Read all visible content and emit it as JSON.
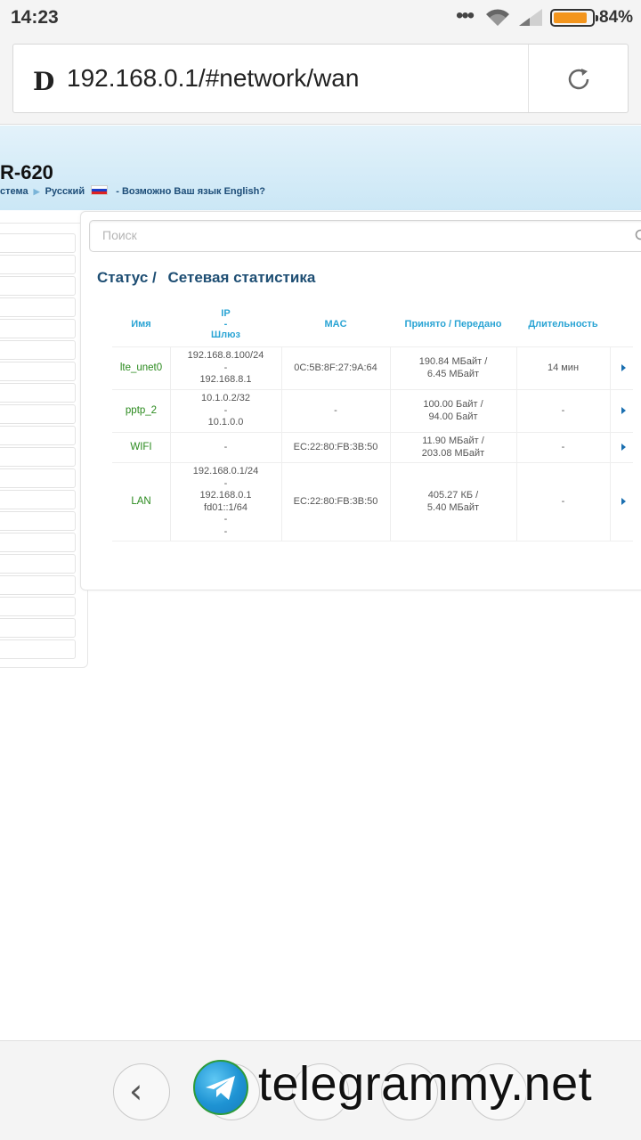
{
  "status_bar": {
    "time": "14:23",
    "battery_percent": "84%",
    "battery_level": 0.84,
    "battery_color": "#f3951d"
  },
  "browser": {
    "url": "192.168.0.1/#network/wan",
    "site_icon": "D",
    "reload_icon": "reload-icon"
  },
  "header": {
    "model": "R-620",
    "breadcrumb_system": "стема",
    "language": "Русский",
    "language_hint": "- Возможно Ваш язык English?"
  },
  "search": {
    "placeholder": "Поиск"
  },
  "page": {
    "crumb_1": "Статус /",
    "crumb_2": "Сетевая статистика"
  },
  "table": {
    "headers": {
      "name": "Имя",
      "ip_1": "IP",
      "ip_2": "-",
      "ip_3": "Шлюз",
      "mac": "MAC",
      "traffic": "Принято / Передано",
      "duration": "Длительность"
    },
    "rows": [
      {
        "name": "lte_unet0",
        "ip_lines": [
          "192.168.8.100/24",
          "-",
          "192.168.8.1"
        ],
        "mac": "0C:5B:8F:27:9A:64",
        "traffic_lines": [
          "190.84 МБайт /",
          "6.45 МБайт"
        ],
        "duration": "14 мин"
      },
      {
        "name": "pptp_2",
        "ip_lines": [
          "10.1.0.2/32",
          "-",
          "10.1.0.0"
        ],
        "mac": "-",
        "traffic_lines": [
          "100.00 Байт /",
          "94.00 Байт"
        ],
        "duration": "-"
      },
      {
        "name": "WIFI",
        "ip_lines": [
          "-"
        ],
        "mac": "EC:22:80:FB:3B:50",
        "traffic_lines": [
          "11.90 МБайт /",
          "203.08 МБайт"
        ],
        "duration": "-"
      },
      {
        "name": "LAN",
        "ip_lines": [
          "192.168.0.1/24",
          "-",
          "192.168.0.1",
          "fd01::1/64",
          "-",
          "-"
        ],
        "mac": "EC:22:80:FB:3B:50",
        "traffic_lines": [
          "405.27 КБ /",
          "5.40 МБайт"
        ],
        "duration": "-"
      }
    ]
  },
  "bottom_nav": {
    "back_glyph": "‹"
  },
  "watermark": {
    "text": "telegrammy.net"
  }
}
